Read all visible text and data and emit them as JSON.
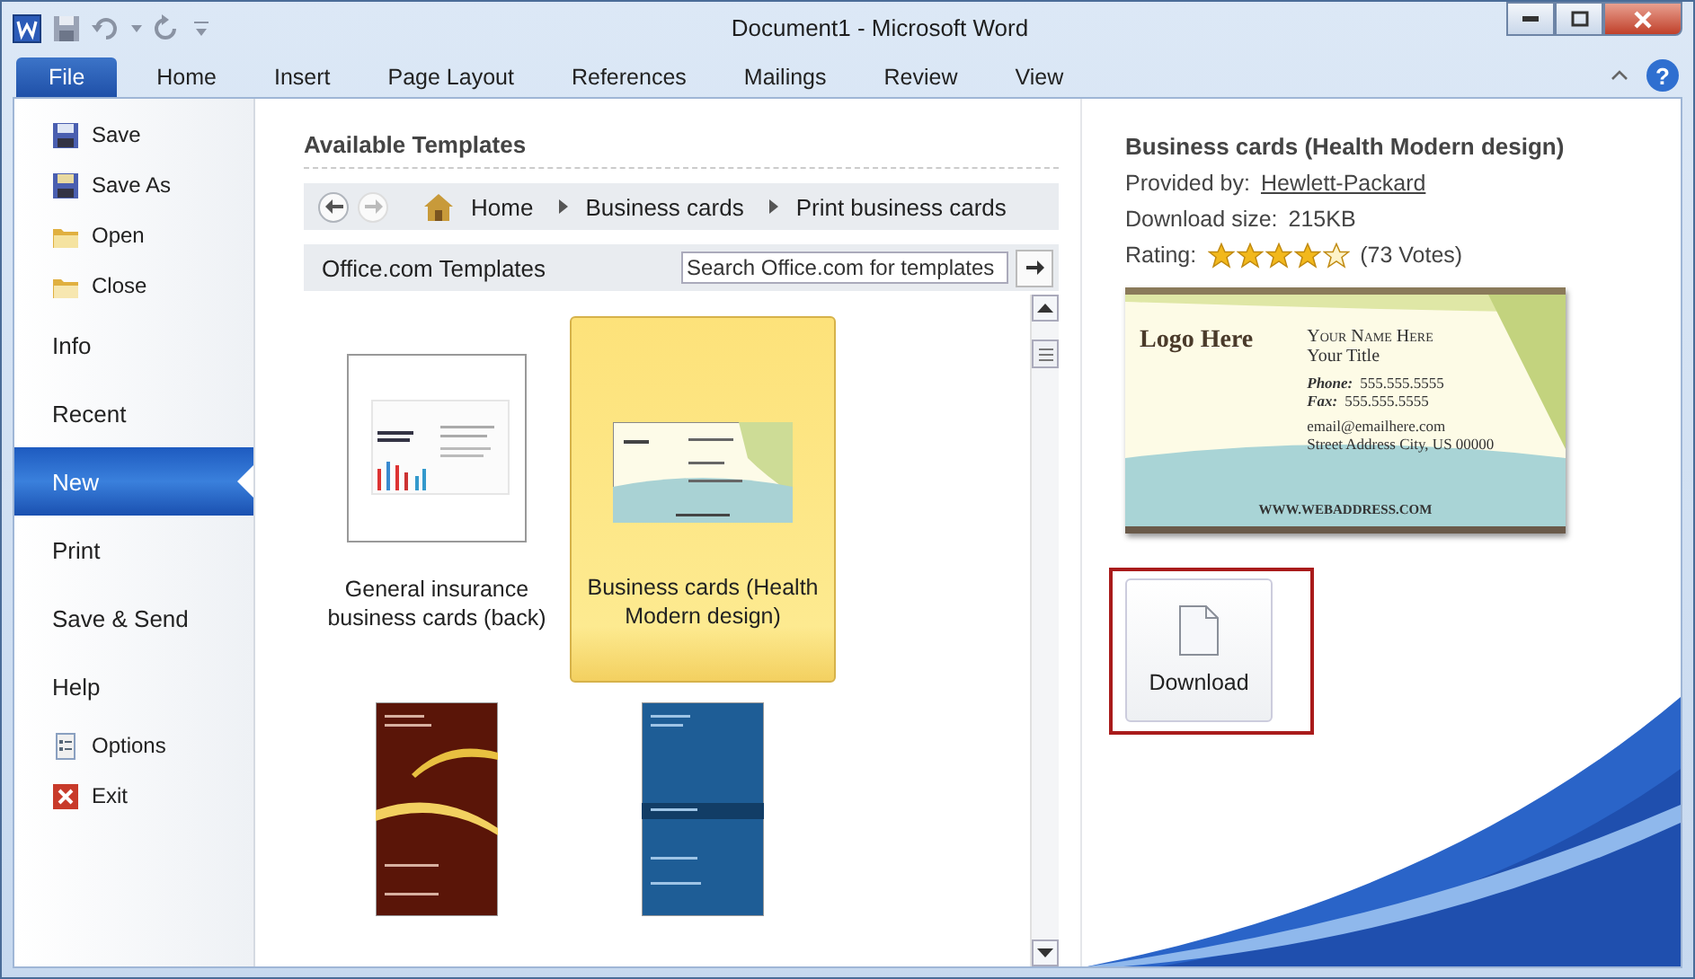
{
  "window": {
    "title": "Document1  -  Microsoft Word"
  },
  "help_button": "?",
  "ribbon_tabs": [
    {
      "label": "File",
      "kind": "file",
      "selected": true
    },
    {
      "label": "Home",
      "kind": "tab",
      "selected": false
    },
    {
      "label": "Insert",
      "kind": "tab",
      "selected": false
    },
    {
      "label": "Page Layout",
      "kind": "tab",
      "selected": false
    },
    {
      "label": "References",
      "kind": "tab",
      "selected": false
    },
    {
      "label": "Mailings",
      "kind": "tab",
      "selected": false
    },
    {
      "label": "Review",
      "kind": "tab",
      "selected": false
    },
    {
      "label": "View",
      "kind": "tab",
      "selected": false
    }
  ],
  "backstage_nav": [
    {
      "label": "Save",
      "kind": "command",
      "selected": false
    },
    {
      "label": "Save As",
      "kind": "command",
      "selected": false
    },
    {
      "label": "Open",
      "kind": "command",
      "selected": false
    },
    {
      "label": "Close",
      "kind": "command",
      "selected": false
    },
    {
      "label": "Info",
      "kind": "section",
      "selected": false
    },
    {
      "label": "Recent",
      "kind": "section",
      "selected": false
    },
    {
      "label": "New",
      "kind": "section",
      "selected": true
    },
    {
      "label": "Print",
      "kind": "section",
      "selected": false
    },
    {
      "label": "Save & Send",
      "kind": "section",
      "selected": false
    },
    {
      "label": "Help",
      "kind": "section",
      "selected": false
    },
    {
      "label": "Options",
      "kind": "command",
      "selected": false
    },
    {
      "label": "Exit",
      "kind": "command",
      "selected": false
    }
  ],
  "templates": {
    "heading": "Available Templates",
    "breadcrumb": [
      "Home",
      "Business cards",
      "Print business cards"
    ],
    "source_label": "Office.com Templates",
    "search": {
      "placeholder": "Search Office.com for templates"
    },
    "items": [
      {
        "label": "General insurance business cards (back)",
        "selected": false
      },
      {
        "label": "Business cards (Health Modern design)",
        "selected": true
      },
      {
        "selected": false
      },
      {
        "selected": false
      }
    ]
  },
  "details": {
    "title": "Business cards (Health Modern design)",
    "provided_by_label": "Provided by:",
    "provider": "Hewlett-Packard",
    "size_label": "Download size:",
    "size": "215KB",
    "rating_label": "Rating:",
    "stars": 4,
    "votes": "(73 Votes)",
    "preview": {
      "logo": "Logo Here",
      "name": "Your Name Here",
      "title": "Your Title",
      "phone_label": "Phone:",
      "phone": "555.555.5555",
      "fax_label": "Fax:",
      "fax": "555.555.5555",
      "email": "email@emailhere.com",
      "address": "Street Address City, US 00000",
      "web": "WWW.WEBADDRESS.COM"
    },
    "download_button": "Download"
  }
}
